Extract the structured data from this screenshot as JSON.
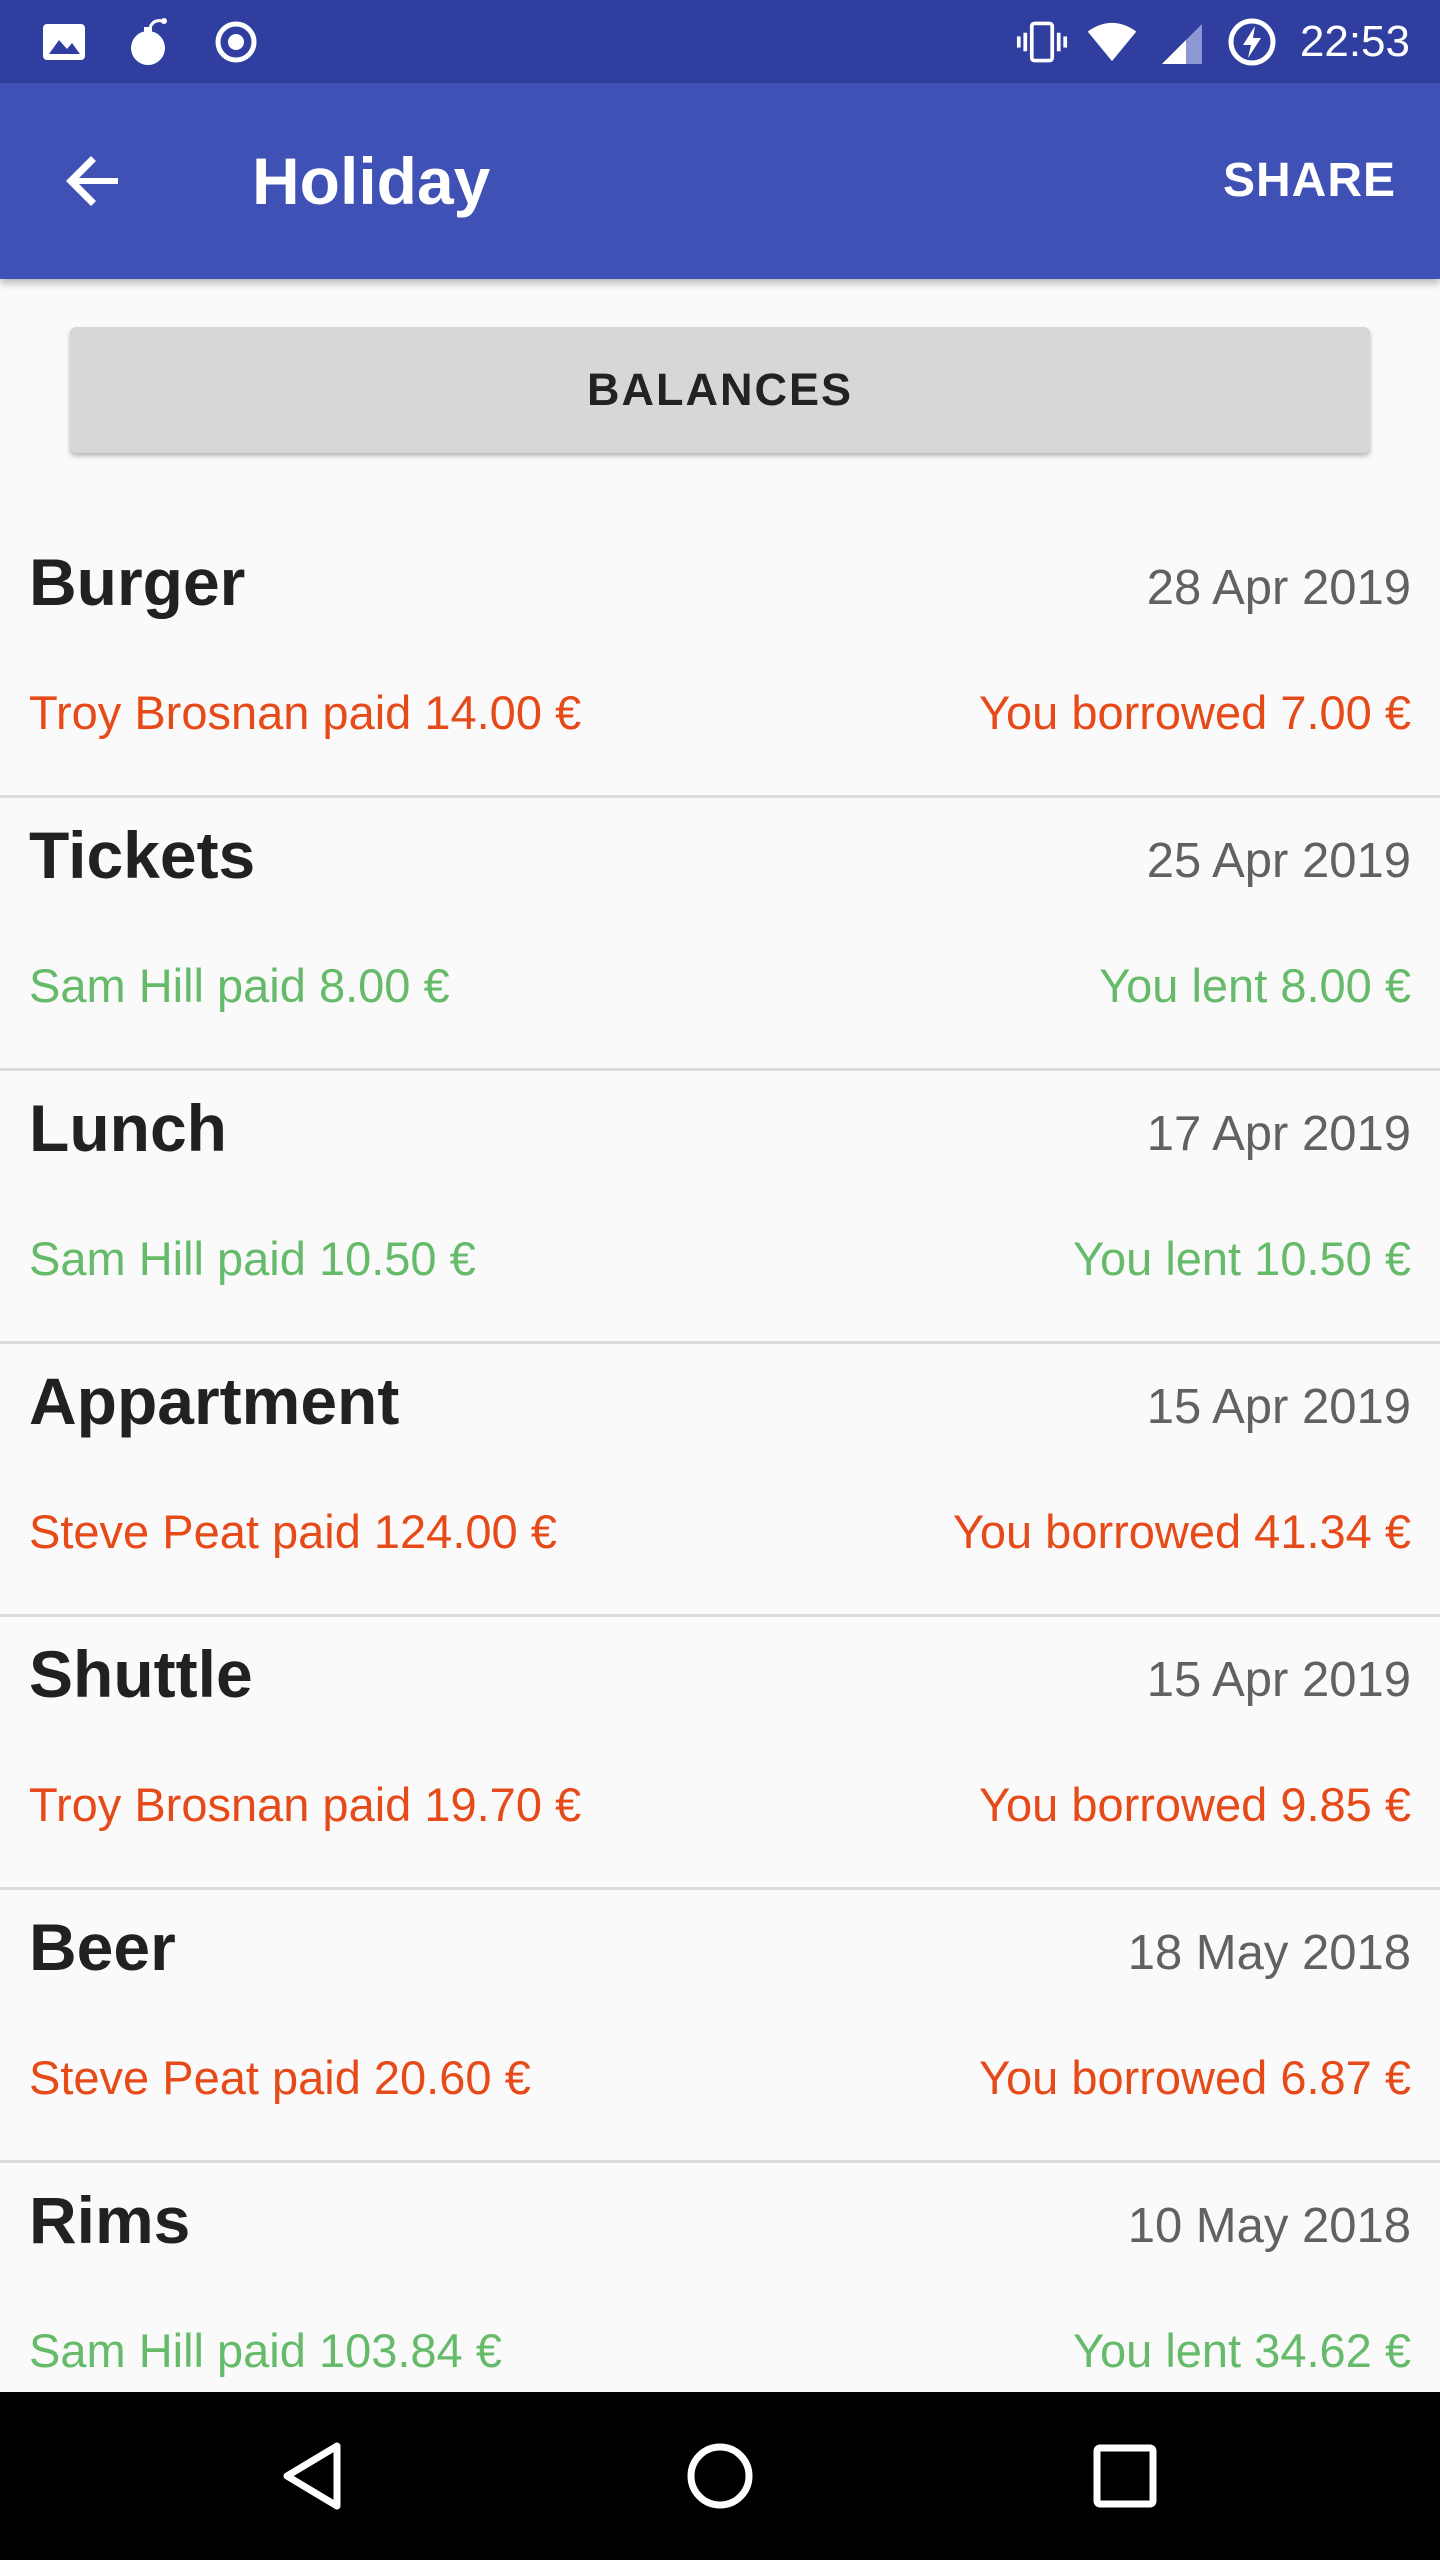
{
  "status_bar": {
    "time": "22:53",
    "left_icons": [
      "image-icon",
      "bomb-icon",
      "record-icon"
    ],
    "right_icons": [
      "vibrate-icon",
      "wifi-icon",
      "cell-signal-icon",
      "battery-charging-icon"
    ]
  },
  "app_bar": {
    "title": "Holiday",
    "share_label": "SHARE",
    "back_icon": "arrow-back-icon"
  },
  "balances_label": "BALANCES",
  "colors": {
    "primary": "#3f51b5",
    "primary_dark": "#303f9f",
    "borrowed": "#e64a19",
    "lent": "#66bb6a",
    "background": "#fafafa"
  },
  "expenses": [
    {
      "name": "Burger",
      "date": "28 Apr 2019",
      "paid": "Troy Brosnan paid 14.00 €",
      "share": "You borrowed 7.00 €",
      "status": "borrowed"
    },
    {
      "name": "Tickets",
      "date": "25 Apr 2019",
      "paid": "Sam Hill paid 8.00 €",
      "share": "You lent 8.00 €",
      "status": "lent"
    },
    {
      "name": "Lunch",
      "date": "17 Apr 2019",
      "paid": "Sam Hill paid 10.50 €",
      "share": "You lent 10.50 €",
      "status": "lent"
    },
    {
      "name": "Appartment",
      "date": "15 Apr 2019",
      "paid": "Steve Peat paid 124.00 €",
      "share": "You borrowed 41.34 €",
      "status": "borrowed"
    },
    {
      "name": "Shuttle",
      "date": "15 Apr 2019",
      "paid": "Troy Brosnan paid 19.70 €",
      "share": "You borrowed 9.85 €",
      "status": "borrowed"
    },
    {
      "name": "Beer",
      "date": "18 May 2018",
      "paid": "Steve Peat paid 20.60 €",
      "share": "You borrowed 6.87 €",
      "status": "borrowed"
    },
    {
      "name": "Rims",
      "date": "10 May 2018",
      "paid": "Sam Hill paid 103.84 €",
      "share": "You lent 34.62 €",
      "status": "lent"
    }
  ],
  "nav_bar": {
    "icons": [
      "nav-back-icon",
      "nav-home-icon",
      "nav-recents-icon"
    ]
  }
}
